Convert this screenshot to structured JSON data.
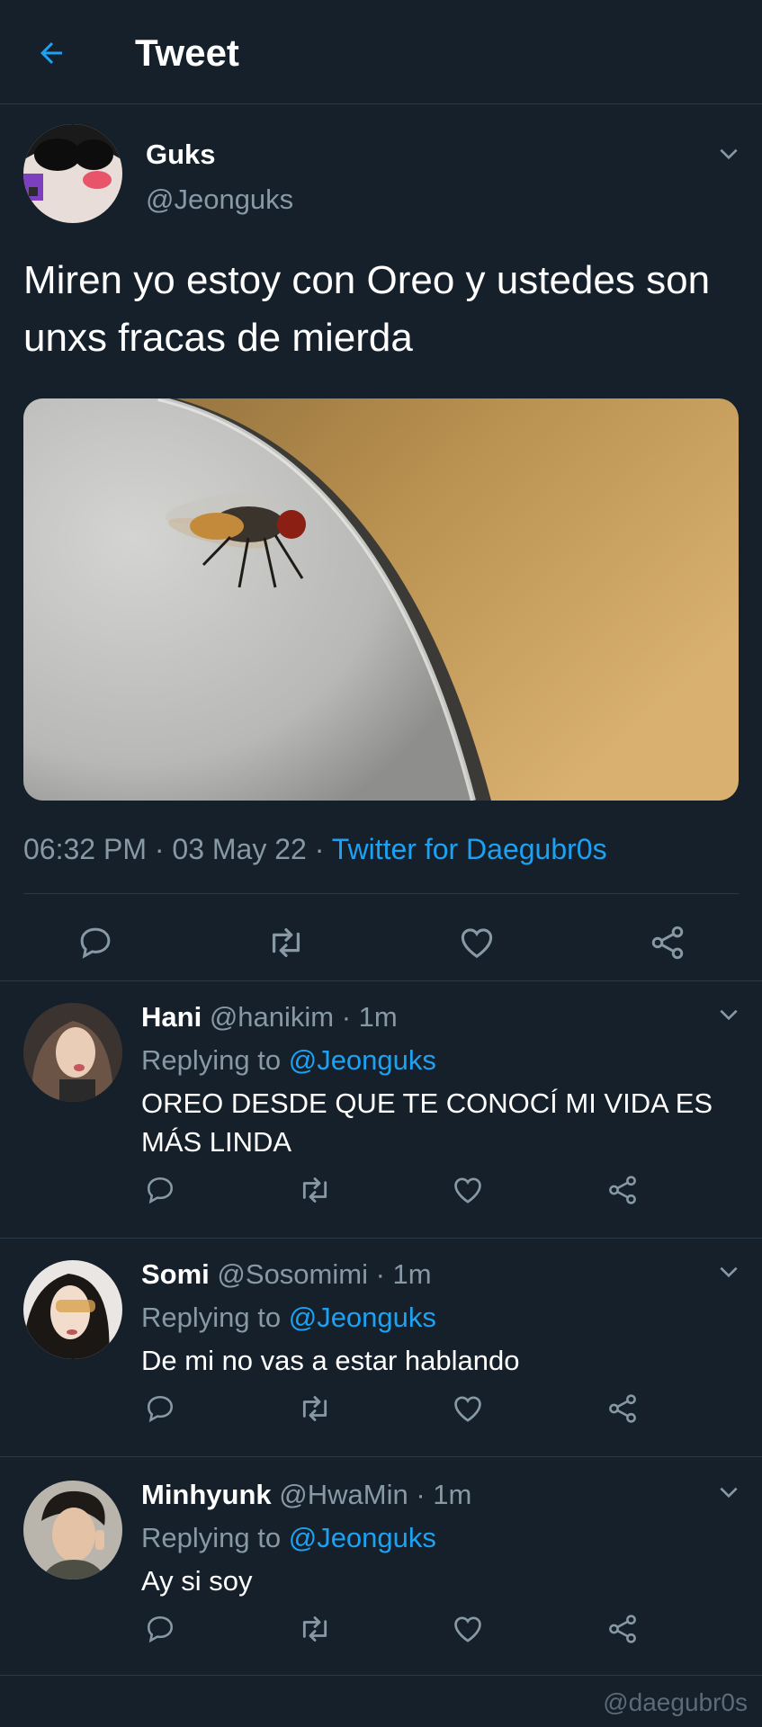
{
  "header": {
    "title": "Tweet"
  },
  "tweet": {
    "author_name": "Guks",
    "author_handle": "@Jeonguks",
    "text": "Miren yo estoy con Oreo y ustedes son unxs fracas de mierda",
    "time": "06:32 PM",
    "date": "03 May 22",
    "source": "Twitter for Daegubr0s",
    "separator": " · "
  },
  "replies": [
    {
      "name": "Hani",
      "handle": "@hanikim",
      "time": "1m",
      "replying_label": "Replying to",
      "replying_to": "@Jeonguks",
      "text": "OREO DESDE QUE TE CONOCÍ MI VIDA ES MÁS LINDA"
    },
    {
      "name": "Somi",
      "handle": "@Sosomimi",
      "time": "1m",
      "replying_label": "Replying to",
      "replying_to": "@Jeonguks",
      "text": "De mi no vas a estar hablando"
    },
    {
      "name": "Minhyunk",
      "handle": "@HwaMin",
      "time": "1m",
      "replying_label": "Replying to",
      "replying_to": "@Jeonguks",
      "text": "Ay si soy"
    }
  ],
  "watermark": "@daegubr0s",
  "icons": {
    "back": "arrow-left-icon",
    "caret": "chevron-down-icon",
    "reply": "reply-icon",
    "retweet": "retweet-icon",
    "like": "heart-icon",
    "share": "share-icon"
  },
  "colors": {
    "background": "#15202b",
    "accent": "#1da1f2",
    "secondary_text": "#8899a6",
    "divider": "#2b3a48"
  }
}
